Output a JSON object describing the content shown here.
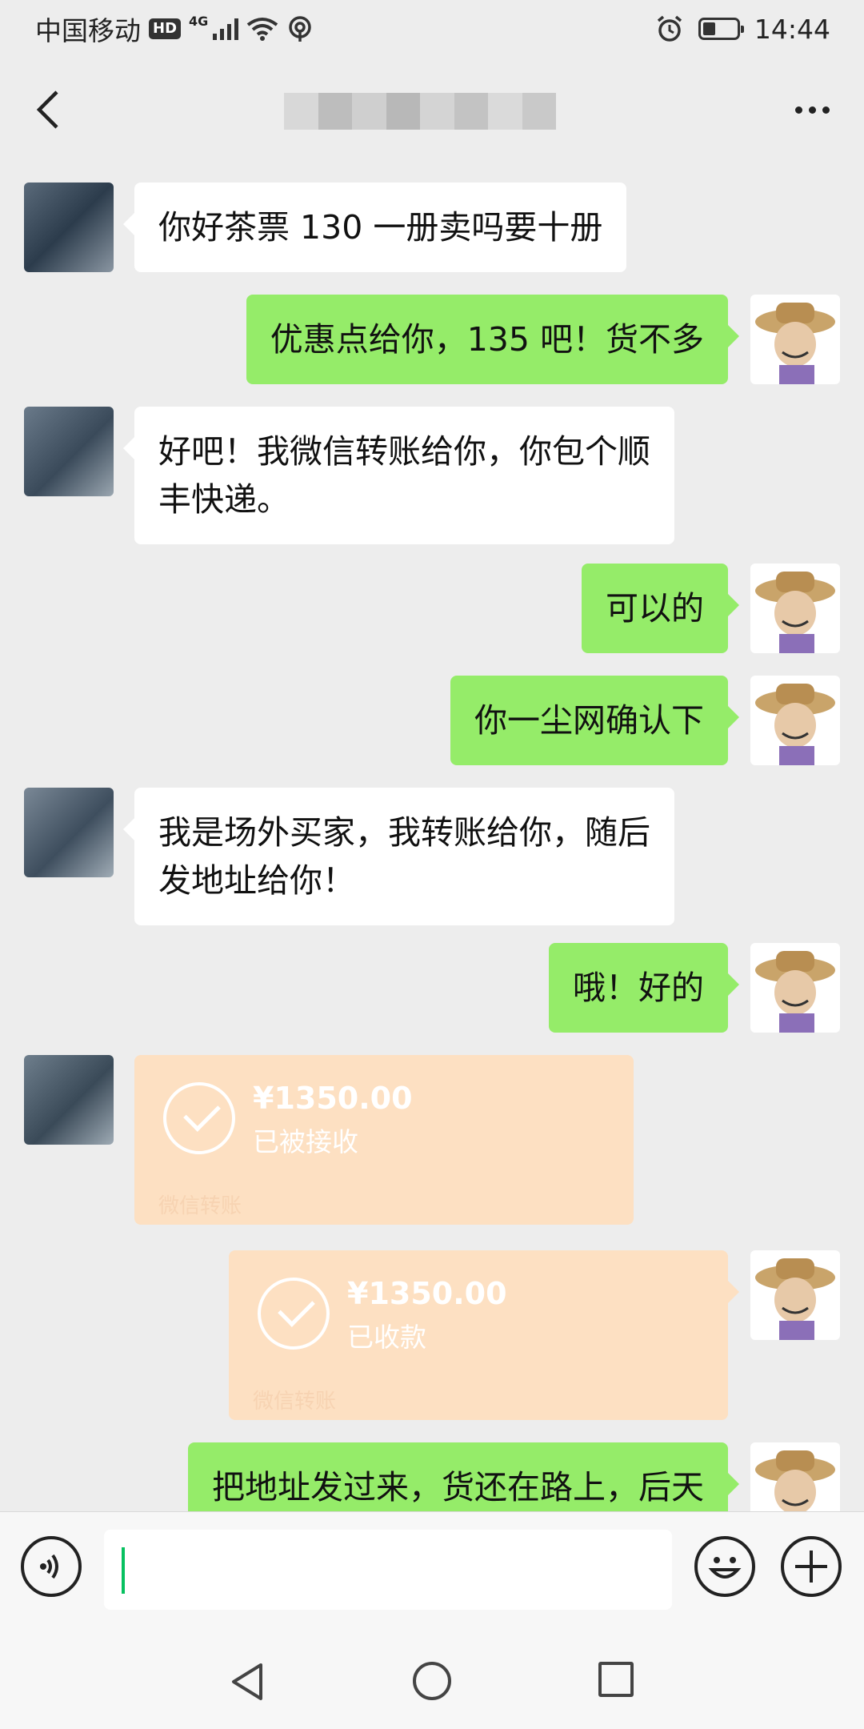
{
  "status_bar": {
    "carrier": "中国移动",
    "hd_badge": "HD",
    "network": "4G",
    "time": "14:44",
    "battery_level": 0.38
  },
  "header": {
    "contact_name": "",
    "icons": {
      "back": "chevron-left-icon",
      "more": "more-horizontal-icon"
    }
  },
  "messages": [
    {
      "side": "left",
      "type": "text",
      "text": "你好茶票 130 一册卖吗要十册"
    },
    {
      "side": "right",
      "type": "text",
      "text": "优惠点给你，135 吧！货不多"
    },
    {
      "side": "left",
      "type": "text",
      "lines": [
        "好吧！我微信转账给你，你包个顺",
        "丰快递。"
      ]
    },
    {
      "side": "right",
      "type": "text",
      "text": "可以的"
    },
    {
      "side": "right",
      "type": "text",
      "text": "你一尘网确认下"
    },
    {
      "side": "left",
      "type": "text",
      "lines": [
        "我是场外买家，我转账给你，随后",
        "发地址给你！"
      ]
    },
    {
      "side": "right",
      "type": "text",
      "text": "哦！好的"
    },
    {
      "side": "left",
      "type": "transfer",
      "amount": "¥1350.00",
      "status": "已被接收",
      "footer": "微信转账"
    },
    {
      "side": "right",
      "type": "transfer",
      "amount": "¥1350.00",
      "status": "已收款",
      "footer": "微信转账"
    },
    {
      "side": "right",
      "type": "text",
      "text": "把地址发过来，货还在路上，后天"
    }
  ],
  "input_bar": {
    "placeholder": "",
    "icons": {
      "voice": "voice-icon",
      "emoji": "emoji-icon",
      "plus": "plus-icon"
    }
  },
  "nav_bar": {
    "icons": {
      "back": "triangle-back-icon",
      "home": "circle-home-icon",
      "recent": "square-recent-icon"
    }
  },
  "colors": {
    "background": "#ededed",
    "my_bubble": "#95ec69",
    "their_bubble": "#ffffff",
    "transfer_bubble": "#fde0c2",
    "caret": "#07c160"
  }
}
